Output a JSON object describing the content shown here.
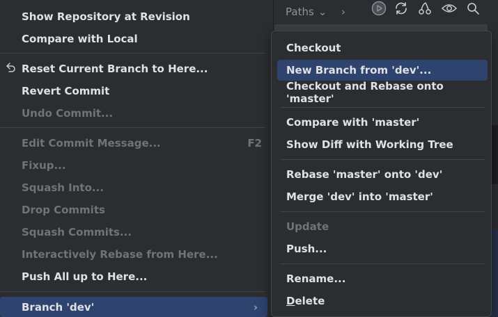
{
  "main_menu": {
    "items": [
      {
        "label": "Show Repository at Revision"
      },
      {
        "label": "Compare with Local"
      },
      {
        "label": "Reset Current Branch to Here..."
      },
      {
        "label": "Revert Commit"
      },
      {
        "label": "Undo Commit..."
      },
      {
        "label": "Edit Commit Message...",
        "shortcut": "F2"
      },
      {
        "label": "Fixup..."
      },
      {
        "label": "Squash Into..."
      },
      {
        "label": "Drop Commits"
      },
      {
        "label": "Squash Commits..."
      },
      {
        "label": "Interactively Rebase from Here..."
      },
      {
        "label": "Push All up to Here..."
      },
      {
        "label": "Branch 'dev'"
      }
    ]
  },
  "toolbar": {
    "paths_label": "Paths"
  },
  "submenu": {
    "items": [
      {
        "label": "Checkout"
      },
      {
        "label": "New Branch from 'dev'..."
      },
      {
        "label": "Checkout and Rebase onto 'master'"
      },
      {
        "label": "Compare with 'master'"
      },
      {
        "label": "Show Diff with Working Tree"
      },
      {
        "label": "Rebase 'master' onto 'dev'"
      },
      {
        "label": "Merge 'dev' into 'master'"
      },
      {
        "label": "Update"
      },
      {
        "label": "Push..."
      },
      {
        "label": "Rename..."
      },
      {
        "label_mnemonic": "D",
        "label_rest": "elete"
      }
    ]
  },
  "colors": {
    "selection": "#2e436e",
    "background": "#2b2d30",
    "text": "#dfe1e5",
    "disabled_text": "#6f737a"
  }
}
